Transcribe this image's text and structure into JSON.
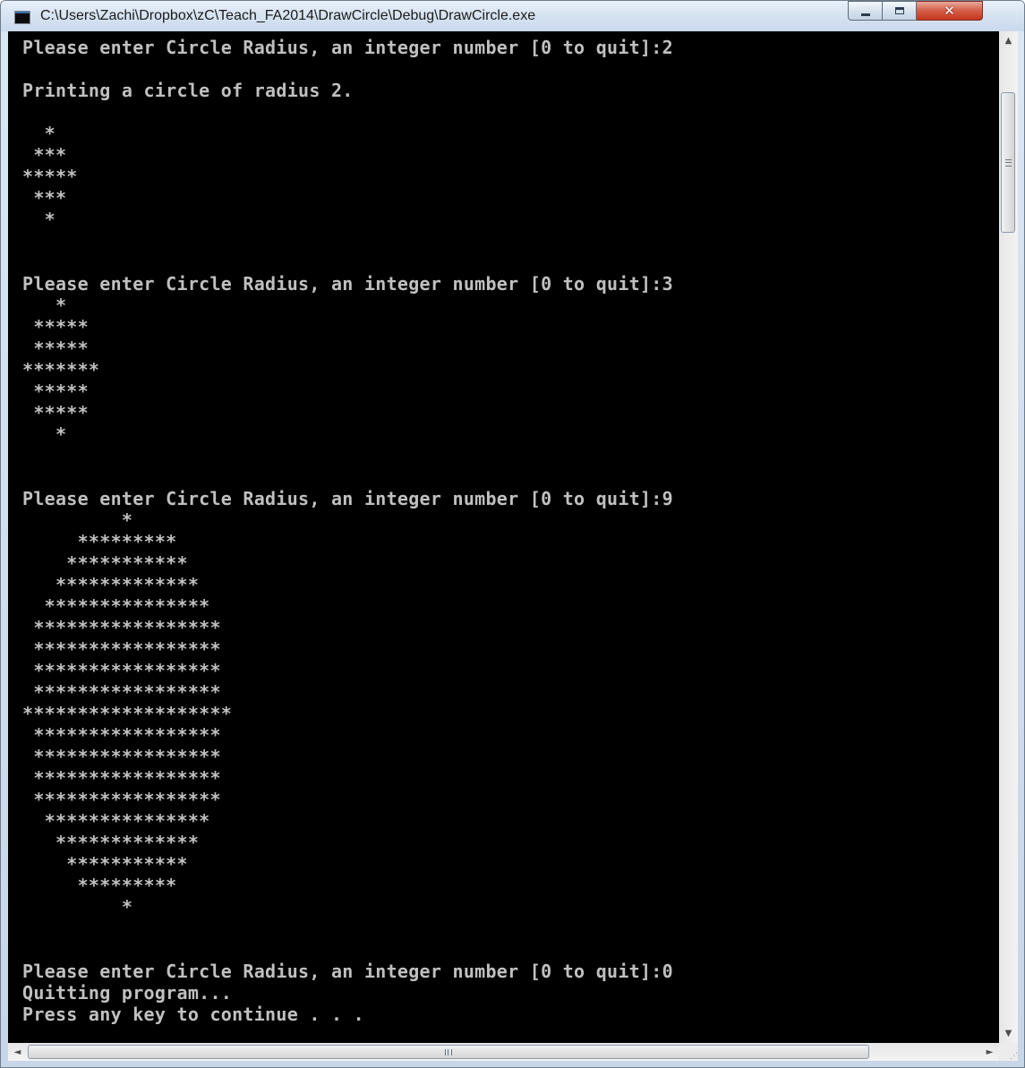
{
  "window": {
    "title": "C:\\Users\\Zachi\\Dropbox\\zC\\Teach_FA2014\\DrawCircle\\Debug\\DrawCircle.exe",
    "icon": "console-app-icon",
    "controls": {
      "minimize": "minimize-icon",
      "maximize": "maximize-icon",
      "close": "close-icon"
    }
  },
  "colors": {
    "console_bg": "#000000",
    "console_text": "#c0c0c0",
    "close_button": "#c4371f"
  },
  "console": {
    "lines": [
      "Please enter Circle Radius, an integer number [0 to quit]:2",
      "",
      "Printing a circle of radius 2.",
      "",
      "  *",
      " ***",
      "*****",
      " ***",
      "  *",
      "",
      "",
      "Please enter Circle Radius, an integer number [0 to quit]:3",
      "   *",
      " *****",
      " *****",
      "*******",
      " *****",
      " *****",
      "   *",
      "",
      "",
      "Please enter Circle Radius, an integer number [0 to quit]:9",
      "         *",
      "     *********",
      "    ***********",
      "   *************",
      "  ***************",
      " *****************",
      " *****************",
      " *****************",
      " *****************",
      "*******************",
      " *****************",
      " *****************",
      " *****************",
      " *****************",
      "  ***************",
      "   *************",
      "    ***********",
      "     *********",
      "         *",
      "",
      "",
      "Please enter Circle Radius, an integer number [0 to quit]:0",
      "Quitting program...",
      "Press any key to continue . . ."
    ]
  },
  "scrollbars": {
    "vertical": {
      "up": "▲",
      "down": "▼",
      "position": 0.08
    },
    "horizontal": {
      "left": "◄",
      "right": "►",
      "grip": "III"
    }
  }
}
